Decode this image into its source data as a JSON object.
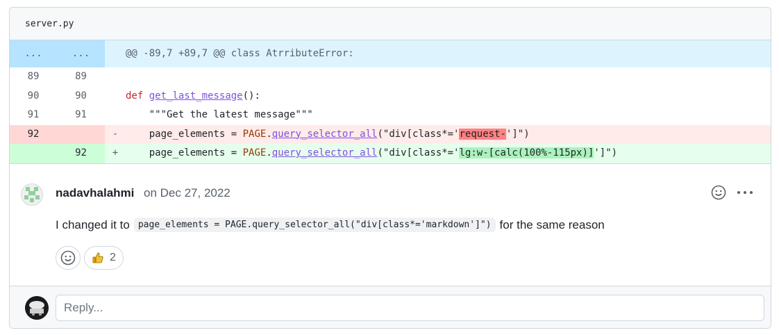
{
  "file": {
    "name": "server.py"
  },
  "diff": {
    "hunk": {
      "old": "...",
      "new": "...",
      "header": "@@ -89,7 +89,7 @@ class AtrributeError:"
    },
    "lines": [
      {
        "old": "89",
        "new": "89",
        "marker": ""
      },
      {
        "old": "90",
        "new": "90",
        "marker": "",
        "kw": "def",
        "fn": "get_last_message",
        "rest": "():"
      },
      {
        "old": "91",
        "new": "91",
        "marker": "",
        "text": "    \"\"\"Get the latest message\"\"\""
      },
      {
        "old": "92",
        "new": "",
        "marker": "-",
        "var": "page_elements",
        "eq": " = ",
        "obj": "PAGE",
        "dot": ".",
        "method": "query_selector_all",
        "pre": "(\"div[class*='",
        "hl": "request-",
        "post": "']\")"
      },
      {
        "old": "",
        "new": "92",
        "marker": "+",
        "var": "page_elements",
        "eq": " = ",
        "obj": "PAGE",
        "dot": ".",
        "method": "query_selector_all",
        "pre": "(\"div[class*='",
        "hl": "lg:w-[calc(100%-115px)]",
        "post": "']\")"
      }
    ]
  },
  "comment": {
    "author": "nadavhalahmi",
    "date": "on Dec 27, 2022",
    "text_before": "I changed it to",
    "code": "page_elements = PAGE.query_selector_all(\"div[class*='markdown']\")",
    "text_after": "for the same reason",
    "reactions": [
      {
        "icon": "thumbs-up-icon",
        "count": "2"
      }
    ]
  },
  "reply": {
    "placeholder": "Reply..."
  },
  "colors": {
    "deleted_bg": "#ffebe9",
    "added_bg": "#e6ffec",
    "hunk_bg": "#ddf4ff",
    "keyword": "#cf222e",
    "function": "#8250df"
  }
}
